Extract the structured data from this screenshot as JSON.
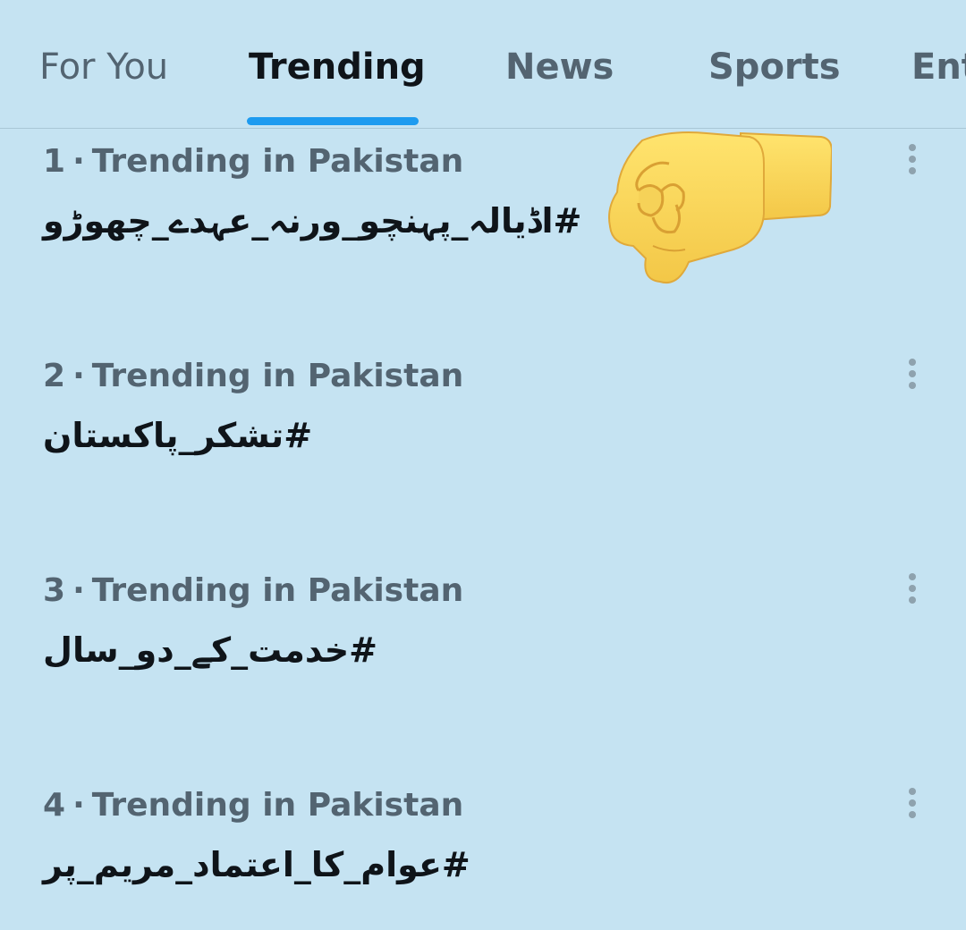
{
  "tabs": [
    {
      "label": "For You",
      "active": false
    },
    {
      "label": "Trending",
      "active": true
    },
    {
      "label": "News",
      "active": false
    },
    {
      "label": "Sports",
      "active": false
    },
    {
      "label": "Ent",
      "active": false
    }
  ],
  "trends": [
    {
      "rank": "1",
      "context": "Trending in Pakistan",
      "name": "#اڈیالہ_پہنچو_ورنہ_عہدے_چھوڑو"
    },
    {
      "rank": "2",
      "context": "Trending in Pakistan",
      "name": "#تشکر_پاکستان"
    },
    {
      "rank": "3",
      "context": "Trending in Pakistan",
      "name": "#خدمت_کے_دو_سال"
    },
    {
      "rank": "4",
      "context": "Trending in Pakistan",
      "name": "#عوام_کا_اعتماد_مریم_پر"
    }
  ],
  "separator": "·",
  "icons": {
    "more": "more-vertical-icon",
    "emoji": "oncoming-fist-emoji"
  },
  "colors": {
    "background": "#c5e3f2",
    "accent": "#1d9bf0",
    "primary_text": "#0f1419",
    "secondary_text": "#536471"
  }
}
